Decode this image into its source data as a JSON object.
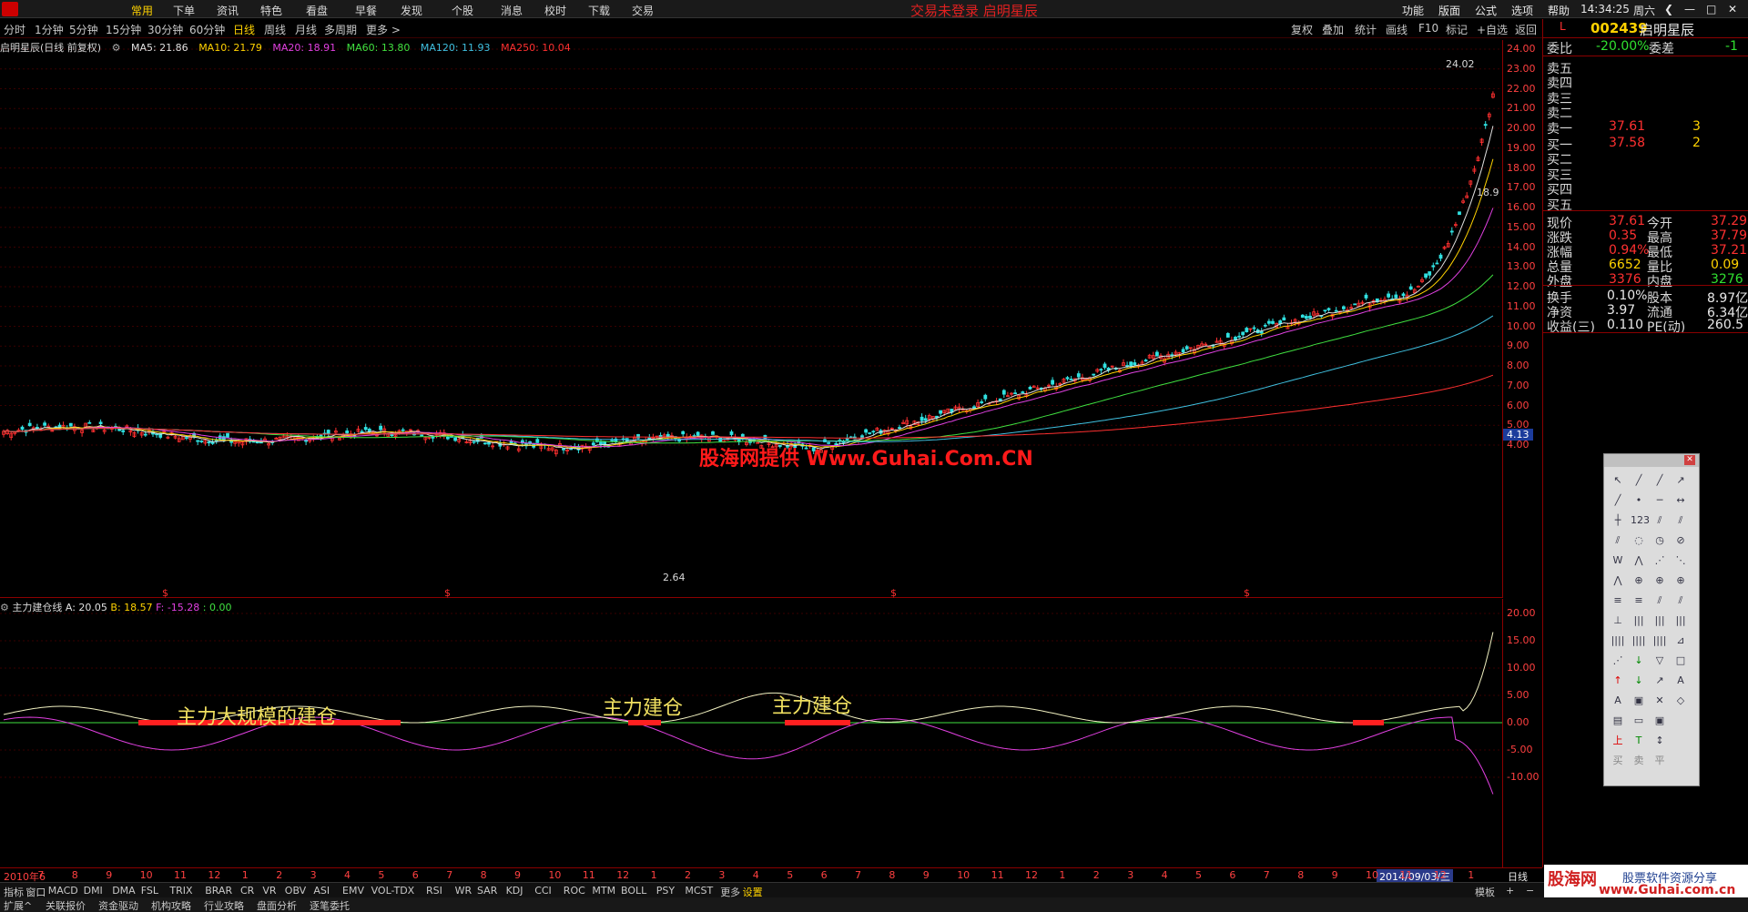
{
  "menubar": {
    "items": [
      "常用",
      "下单",
      "资讯",
      "特色",
      "看盘",
      "早餐",
      "发现",
      "个股",
      "消息",
      "校时",
      "下载",
      "交易"
    ],
    "center_title": "交易未登录   启明星辰",
    "right_items": [
      "功能",
      "版面",
      "公式",
      "选项",
      "帮助"
    ],
    "clock": "14:34:25",
    "weekday": "周六"
  },
  "periods": [
    "分时",
    "1分钟",
    "5分钟",
    "15分钟",
    "30分钟",
    "60分钟",
    "日线",
    "周线",
    "月线",
    "多周期",
    "更多 >"
  ],
  "active_period": "日线",
  "right_tools": [
    "复权",
    "叠加",
    "统计",
    "画线",
    "F10",
    "标记",
    "+自选",
    "返回"
  ],
  "ma_header": {
    "stock": "启明星辰(日线 前复权)",
    "ma5": "MA5: 21.86",
    "ma10": "MA10: 21.79",
    "ma20": "MA20: 18.91",
    "ma60": "MA60: 13.80",
    "ma120": "MA120: 11.93",
    "ma250": "MA250: 10.04"
  },
  "colors": {
    "ma5": "#e0e0e0",
    "ma10": "#ffd200",
    "ma20": "#e040e0",
    "ma60": "#40e040",
    "ma120": "#40c0e0",
    "ma250": "#ff3030",
    "up": "#ff3030",
    "down": "#30e0e0"
  },
  "y_main_ticks": [
    "24.00",
    "23.00",
    "22.00",
    "21.00",
    "20.00",
    "19.00",
    "18.00",
    "17.00",
    "16.00",
    "15.00",
    "14.00",
    "13.00",
    "12.00",
    "11.00",
    "10.00",
    "9.00",
    "8.00",
    "7.00",
    "6.00",
    "5.00",
    "4.00"
  ],
  "y_ind_ticks": [
    "20.00",
    "15.00",
    "10.00",
    "5.00",
    "0.00",
    "-5.00",
    "-10.00"
  ],
  "current_price_marker": "4.13",
  "chart_labels": {
    "high": "24.02",
    "low": "2.64",
    "mid_label": "18.9"
  },
  "indicator_header": {
    "name": "主力建仓线",
    "a": "A: 20.05",
    "b": "B: 18.57",
    "f": "F: -15.28",
    "z": ": 0.00"
  },
  "annotations": [
    "主力大规模的建仓",
    "主力建仓",
    "主力建仓"
  ],
  "watermark": "股海网提供 Www.Guhai.Com.CN",
  "time_labels": [
    "2010年6",
    "7",
    "8",
    "9",
    "10",
    "11",
    "12",
    "1",
    "2",
    "3",
    "4",
    "5",
    "6",
    "7",
    "8",
    "9",
    "10",
    "11",
    "12",
    "1",
    "2",
    "3",
    "4",
    "5",
    "6",
    "7",
    "8",
    "9",
    "10",
    "11",
    "12",
    "1",
    "2",
    "3",
    "4",
    "5",
    "6",
    "7",
    "8",
    "9",
    "10",
    "11",
    "12",
    "1"
  ],
  "selected_date": "2014/09/03/三",
  "bottom_right_label": "日线",
  "quote": {
    "code": "002439",
    "name": "启明星辰",
    "weibi_label": "委比",
    "weibi": "-20.00%",
    "weicha_label": "委差",
    "weicha": "-1",
    "sell": [
      {
        "label": "卖五",
        "price": "",
        "vol": ""
      },
      {
        "label": "卖四",
        "price": "",
        "vol": ""
      },
      {
        "label": "卖三",
        "price": "",
        "vol": ""
      },
      {
        "label": "卖二",
        "price": "",
        "vol": ""
      },
      {
        "label": "卖一",
        "price": "37.61",
        "vol": "3"
      }
    ],
    "buy": [
      {
        "label": "买一",
        "price": "37.58",
        "vol": "2"
      },
      {
        "label": "买二",
        "price": "",
        "vol": ""
      },
      {
        "label": "买三",
        "price": "",
        "vol": ""
      },
      {
        "label": "买四",
        "price": "",
        "vol": ""
      },
      {
        "label": "买五",
        "price": "",
        "vol": ""
      }
    ],
    "stats": [
      {
        "l1": "现价",
        "v1": "37.61",
        "l2": "今开",
        "v2": "37.29",
        "c1": "red",
        "c2": "red"
      },
      {
        "l1": "涨跌",
        "v1": "0.35",
        "l2": "最高",
        "v2": "37.79",
        "c1": "red",
        "c2": "red"
      },
      {
        "l1": "涨幅",
        "v1": "0.94%",
        "l2": "最低",
        "v2": "37.21",
        "c1": "red",
        "c2": "red"
      },
      {
        "l1": "总量",
        "v1": "6652",
        "l2": "量比",
        "v2": "0.09",
        "c1": "yel",
        "c2": "yel"
      },
      {
        "l1": "外盘",
        "v1": "3376",
        "l2": "内盘",
        "v2": "3276",
        "c1": "red",
        "c2": "grn"
      }
    ],
    "fund": [
      {
        "l1": "换手",
        "v1": "0.10%",
        "l2": "股本",
        "v2": "8.97亿"
      },
      {
        "l1": "净资",
        "v1": "3.97",
        "l2": "流通",
        "v2": "6.34亿"
      },
      {
        "l1": "收益(三)",
        "v1": "0.110",
        "l2": "PE(动)",
        "v2": "260.5"
      }
    ]
  },
  "indicator_tabs": [
    "指标",
    "窗口",
    "MACD",
    "DMI",
    "DMA",
    "FSL",
    "TRIX",
    "BRAR",
    "CR",
    "VR",
    "OBV",
    "ASI",
    "EMV",
    "VOL-TDX",
    "RSI",
    "WR",
    "SAR",
    "KDJ",
    "CCI",
    "ROC",
    "MTM",
    "BOLL",
    "PSY",
    "MCST",
    "更多",
    "设置"
  ],
  "template_label": "模板",
  "bottom_tabs": [
    "扩展^",
    "关联报价",
    "资金驱动",
    "机构攻略",
    "行业攻略",
    "盘面分析",
    "逐笔委托"
  ],
  "logo": {
    "l1": "股海网",
    "l2": "股票软件资源分享",
    "l3": "www.Guhai.com.cn"
  },
  "toolbox_bottom": [
    "买",
    "卖",
    "平"
  ]
}
